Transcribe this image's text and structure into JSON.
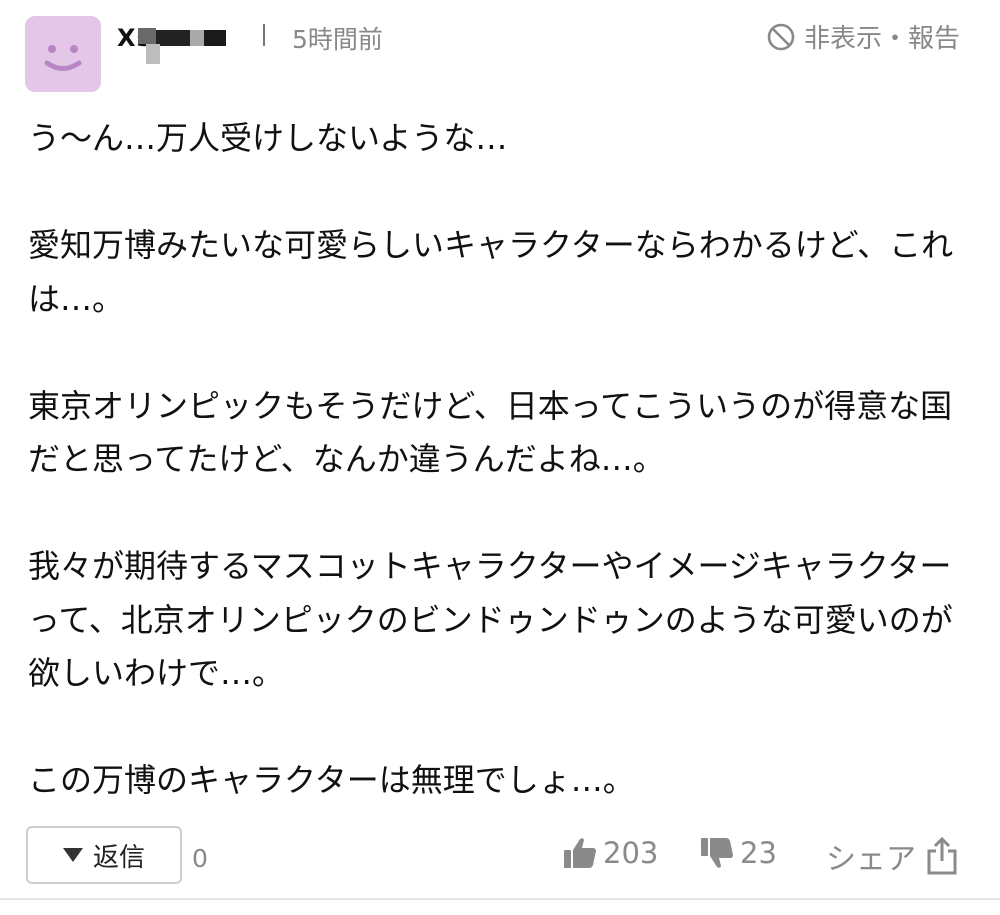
{
  "header": {
    "username": "Xs",
    "timestamp": "5時間前",
    "hide_report_label": "非表示・報告"
  },
  "icons": {
    "avatar": "smiley-face-icon",
    "hide": "prohibited-icon",
    "reply": "caret-down-icon",
    "like": "thumbs-up-icon",
    "dislike": "thumbs-down-icon",
    "share": "share-up-arrow-icon"
  },
  "colors": {
    "avatar_bg": "#e3c6e8",
    "avatar_face": "#b986c4",
    "muted_text": "#888888"
  },
  "comment": {
    "paragraphs": [
      "う〜ん…万人受けしないような…",
      "愛知万博みたいな可愛らしいキャラクターならわかるけど、これは…。",
      "東京オリンピックもそうだけど、日本ってこういうのが得意な国だと思ってたけど、なんか違うんだよね…。",
      "我々が期待するマスコットキャラクターやイメージキャラクターって、北京オリンピックのビンドゥンドゥンのような可愛いのが欲しいわけで…。",
      "この万博のキャラクターは無理でしょ…。"
    ]
  },
  "footer": {
    "reply_label": "返信",
    "reply_count": "0",
    "like_count": "203",
    "dislike_count": "23",
    "share_label": "シェア"
  }
}
